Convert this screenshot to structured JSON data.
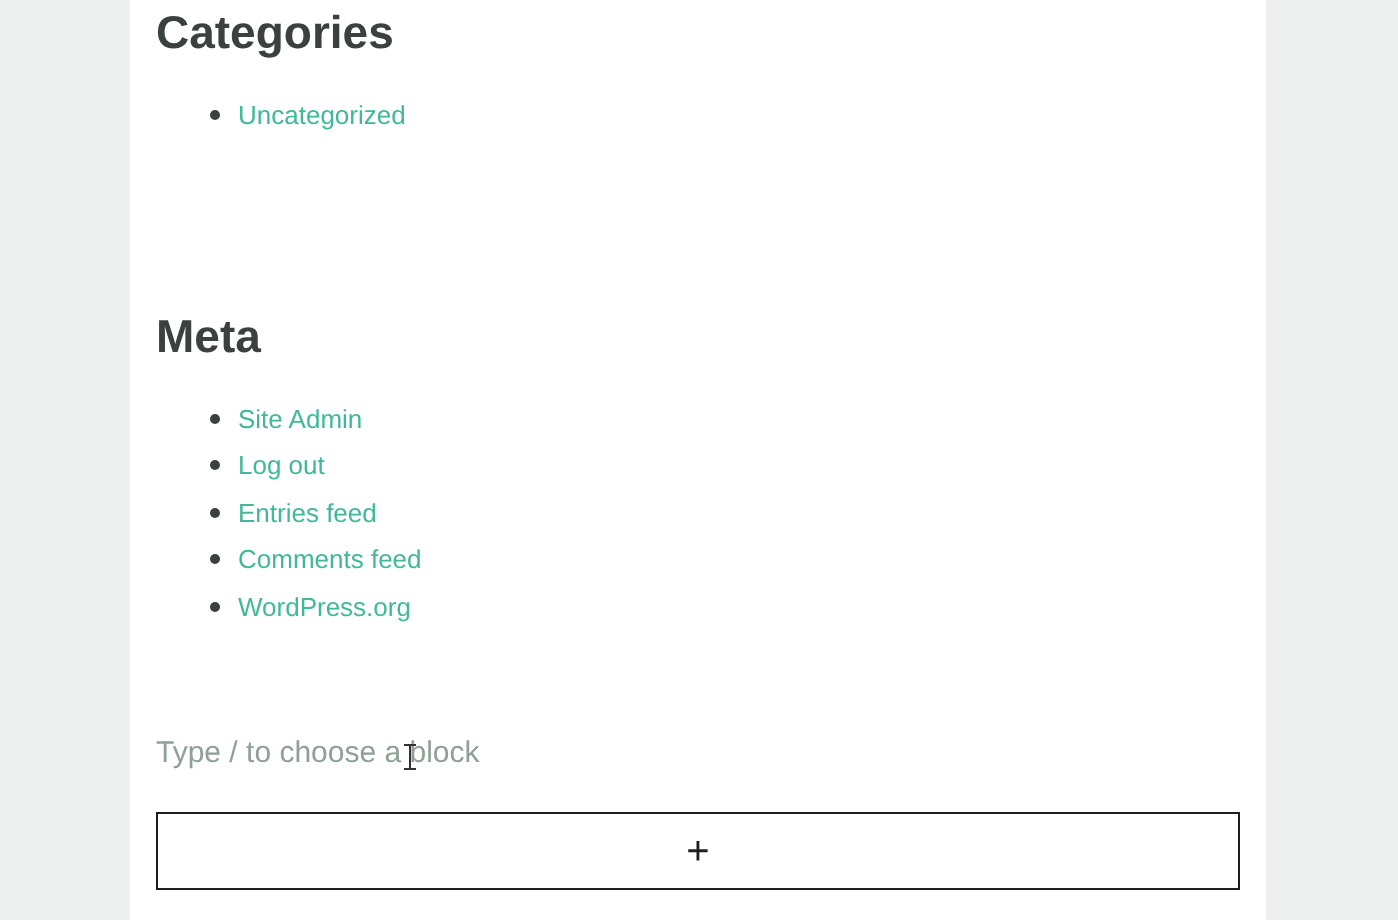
{
  "sections": [
    {
      "heading": "Categories",
      "links": [
        "Uncategorized"
      ]
    },
    {
      "heading": "Meta",
      "links": [
        "Site Admin",
        "Log out",
        "Entries feed",
        "Comments feed",
        "WordPress.org"
      ]
    }
  ],
  "block_input": {
    "placeholder": "Type / to choose a block"
  },
  "add_block_button": {
    "label": "+"
  }
}
